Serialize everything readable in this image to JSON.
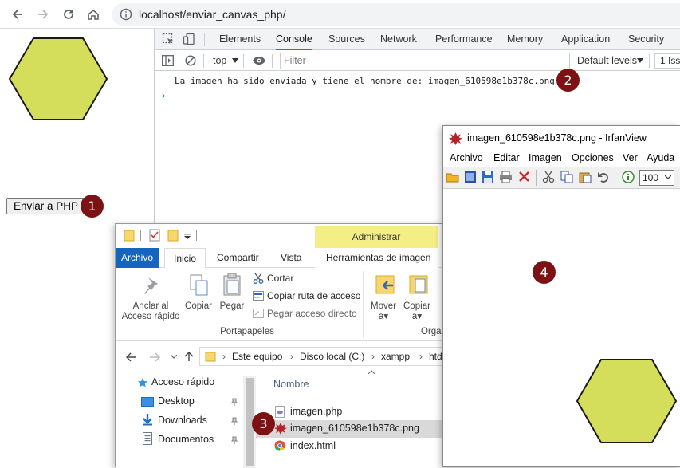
{
  "browser": {
    "url": "localhost/enviar_canvas_php/"
  },
  "page": {
    "send_button_label": "Enviar a PHP",
    "hexagon_color": "#d4de5a"
  },
  "markers": [
    "1",
    "2",
    "3",
    "4"
  ],
  "devtools": {
    "tabs": [
      "Elements",
      "Console",
      "Sources",
      "Network",
      "Performance",
      "Memory",
      "Application",
      "Security"
    ],
    "active_tab": "Console",
    "context": "top",
    "filter_placeholder": "Filter",
    "levels": "Default levels",
    "issues": "1 Iss",
    "console_message": "La imagen ha sido enviada y tiene el nombre de: imagen_610598e1b378c.png",
    "prompt": "›"
  },
  "irfanview": {
    "title": "imagen_610598e1b378c.png - IrfanView",
    "menu": [
      "Archivo",
      "Editar",
      "Imagen",
      "Opciones",
      "Ver",
      "Ayuda"
    ],
    "zoom": "100"
  },
  "explorer": {
    "contextual_group": "Administrar",
    "tabs": [
      "Archivo",
      "Inicio",
      "Compartir",
      "Vista",
      "Herramientas de imagen"
    ],
    "active_tab": "Inicio",
    "ribbon": {
      "pin_label_1": "Anclar al",
      "pin_label_2": "Acceso rápido",
      "copy": "Copiar",
      "paste": "Pegar",
      "cut": "Cortar",
      "copy_path": "Copiar ruta de acceso",
      "paste_shortcut": "Pegar acceso directo",
      "group_clipboard": "Portapapeles",
      "move_1": "Mover",
      "move_2": "a",
      "copy_to_1": "Copiar",
      "copy_to_2": "a",
      "group_organize": "Orga"
    },
    "breadcrumb": [
      "Este equipo",
      "Disco local (C:)",
      "xampp",
      "htd"
    ],
    "nav_items": [
      "Acceso rápido",
      "Desktop",
      "Downloads",
      "Documentos"
    ],
    "column_name": "Nombre",
    "files": [
      "imagen.php",
      "imagen_610598e1b378c.png",
      "index.html"
    ]
  }
}
